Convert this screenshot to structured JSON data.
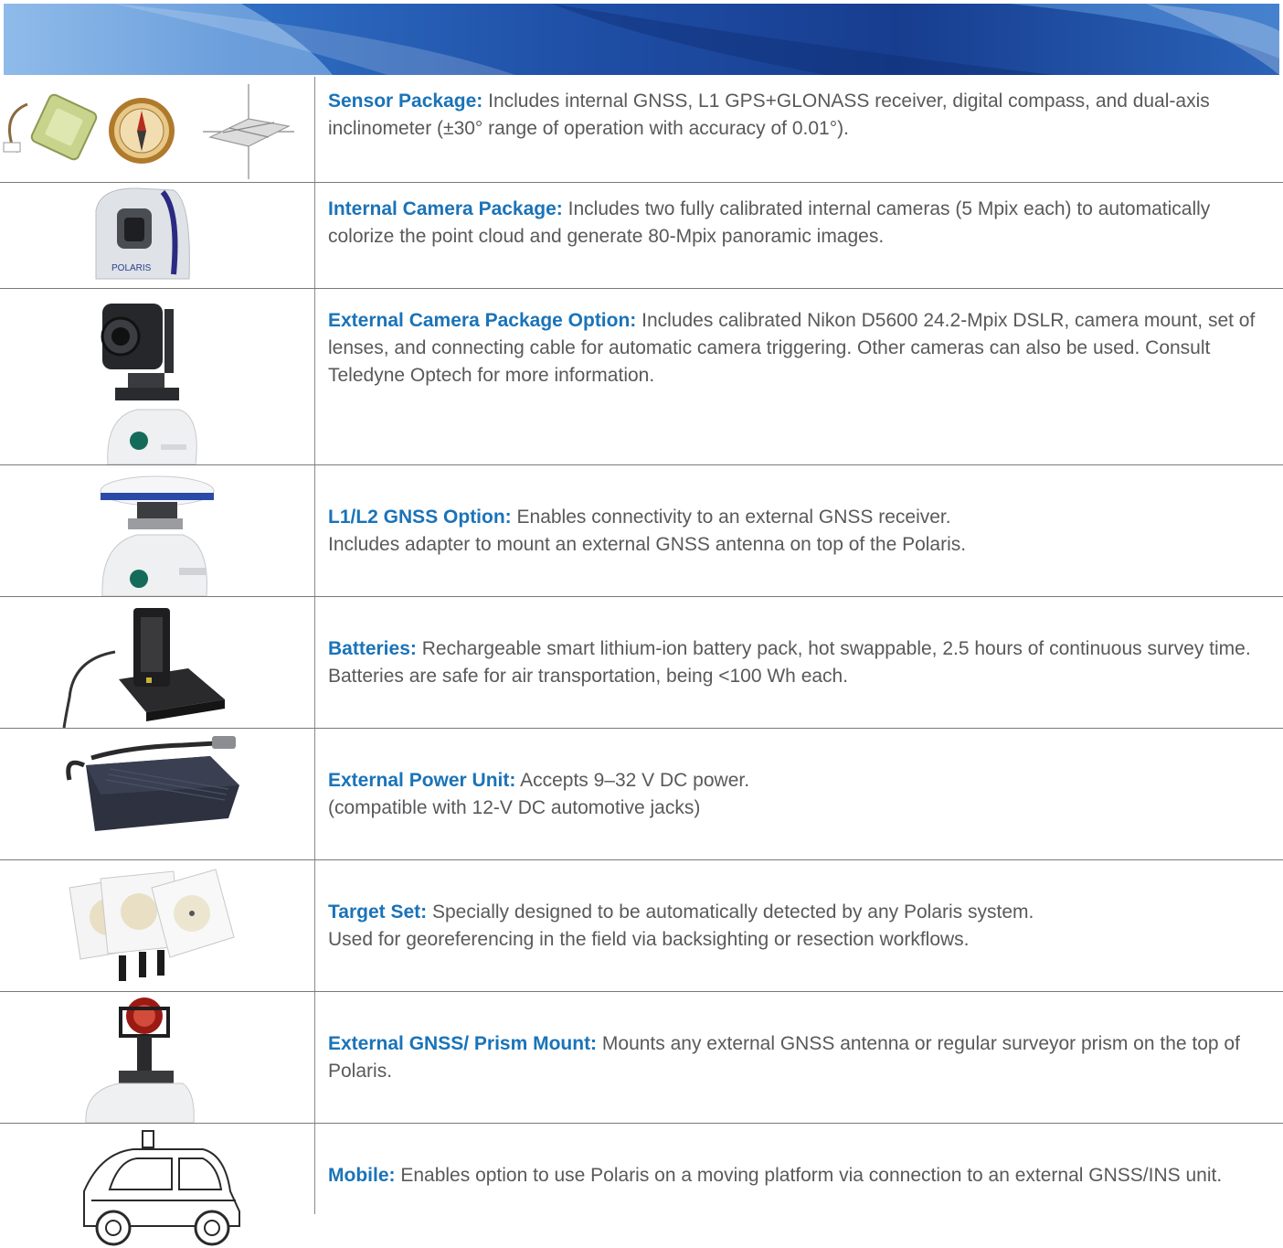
{
  "accent_color": "#1a73b8",
  "body_text_color": "#58595b",
  "banner_colors": [
    "#7fb0e3",
    "#1f4fa6",
    "#173d8f"
  ],
  "rows": [
    {
      "icon": "gnss-compass-inclinometer-image",
      "label": "Sensor Package:",
      "text": "Includes internal GNSS, L1 GPS+GLONASS receiver, digital compass, and dual-axis inclinometer (±30° range of operation with accuracy of 0.01°)."
    },
    {
      "icon": "internal-camera-image",
      "label": "Internal Camera Package:",
      "text": "Includes two fully calibrated internal cameras (5 Mpix each) to automatically colorize the point cloud and generate 80-Mpix panoramic images."
    },
    {
      "icon": "external-camera-image",
      "label": "External Camera Package Option:",
      "text": "Includes calibrated Nikon D5600 24.2-Mpix DSLR, camera mount, set of lenses, and connecting cable for automatic camera triggering. Other cameras can also be used. Consult Teledyne Optech for more information."
    },
    {
      "icon": "gnss-antenna-image",
      "label": "L1/L2 GNSS Option:",
      "text": "Enables connectivity to an external GNSS receiver.\nIncludes adapter to mount an external GNSS antenna on top of the Polaris."
    },
    {
      "icon": "battery-charger-image",
      "label": "Batteries:",
      "text": "Rechargeable smart lithium-ion battery pack, hot swappable, 2.5 hours of continuous survey time. Batteries are safe for air transportation, being <100 Wh each."
    },
    {
      "icon": "power-unit-image",
      "label": "External Power Unit:",
      "text": "Accepts 9–32 V DC power.\n(compatible with 12-V DC automotive jacks)"
    },
    {
      "icon": "target-set-image",
      "label": "Target Set:",
      "text": "Specially designed to be automatically detected by any Polaris system.\nUsed for georeferencing in the field via backsighting or resection workflows."
    },
    {
      "icon": "prism-mount-image",
      "label": "External GNSS/ Prism Mount:",
      "text": "Mounts any external GNSS antenna or regular surveyor prism on the top of Polaris."
    },
    {
      "icon": "car-image",
      "label": "Mobile:",
      "text": "Enables option to use Polaris on a moving platform via connection to an external GNSS/INS unit."
    }
  ],
  "camera_logo_text": "POLARIS"
}
